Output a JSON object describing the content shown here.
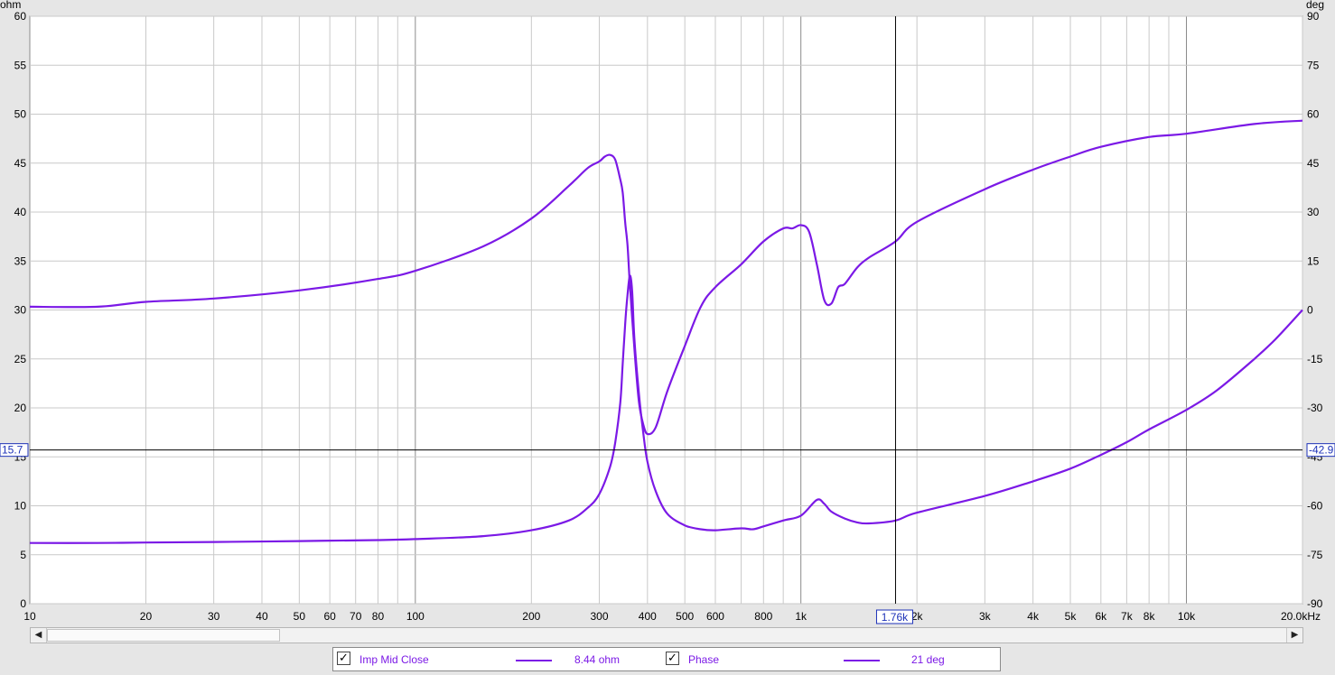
{
  "chart_data": {
    "type": "line",
    "x_scale": "log",
    "xlim": [
      10,
      20000
    ],
    "x_unit": "Hz",
    "x_ticks": [
      "10",
      "20",
      "30",
      "40",
      "50",
      "60",
      "70",
      "80",
      "100",
      "200",
      "300",
      "400",
      "500",
      "600",
      "800",
      "1k",
      "2k",
      "3k",
      "4k",
      "5k",
      "6k",
      "7k",
      "8k",
      "10k",
      "20.0kHz"
    ],
    "x_tick_values": [
      10,
      20,
      30,
      40,
      50,
      60,
      70,
      80,
      100,
      200,
      300,
      400,
      500,
      600,
      800,
      1000,
      2000,
      3000,
      4000,
      5000,
      6000,
      7000,
      8000,
      10000,
      20000
    ],
    "y_left": {
      "unit": "ohm",
      "lim": [
        0,
        60
      ],
      "ticks": [
        "0",
        "5",
        "10",
        "15",
        "20",
        "25",
        "30",
        "35",
        "40",
        "45",
        "50",
        "55",
        "60"
      ]
    },
    "y_right": {
      "unit": "deg",
      "lim": [
        -90,
        90
      ],
      "ticks": [
        "-90",
        "-75",
        "-60",
        "-45",
        "-30",
        "-15",
        "0",
        "15",
        "30",
        "45",
        "60",
        "75",
        "90"
      ]
    },
    "grid": true,
    "series": [
      {
        "name": "Imp Mid Close",
        "axis": "left",
        "color": "#7b19e6",
        "x": [
          10,
          15,
          20,
          30,
          50,
          80,
          100,
          150,
          200,
          250,
          280,
          300,
          320,
          330,
          340,
          345,
          350,
          355,
          360,
          365,
          370,
          380,
          390,
          400,
          420,
          450,
          500,
          550,
          600,
          700,
          750,
          800,
          900,
          1000,
          1100,
          1150,
          1200,
          1300,
          1400,
          1500,
          1760,
          2000,
          3000,
          4000,
          5000,
          6000,
          7000,
          8000,
          10000,
          12000,
          15000,
          17000,
          20000
        ],
        "y": [
          6.2,
          6.2,
          6.25,
          6.3,
          6.4,
          6.5,
          6.6,
          6.9,
          7.5,
          8.5,
          9.8,
          11.2,
          14.0,
          16.5,
          20.5,
          24.5,
          28.5,
          31.5,
          33.5,
          32.0,
          27.0,
          21.5,
          17.5,
          14.5,
          11.5,
          9.2,
          8.0,
          7.6,
          7.5,
          7.7,
          7.6,
          7.9,
          8.5,
          9.0,
          10.6,
          10.2,
          9.4,
          8.7,
          8.3,
          8.2,
          8.5,
          9.3,
          11.0,
          12.5,
          13.8,
          15.2,
          16.5,
          17.8,
          19.8,
          21.8,
          25.0,
          27.0,
          30.0
        ]
      },
      {
        "name": "Phase",
        "axis": "right",
        "color": "#7b19e6",
        "x": [
          10,
          15,
          20,
          30,
          50,
          80,
          100,
          150,
          200,
          250,
          280,
          300,
          310,
          320,
          330,
          340,
          345,
          350,
          355,
          360,
          370,
          380,
          390,
          400,
          420,
          450,
          500,
          550,
          600,
          700,
          800,
          900,
          950,
          1000,
          1050,
          1100,
          1150,
          1200,
          1250,
          1300,
          1400,
          1500,
          1760,
          2000,
          3000,
          4000,
          5000,
          6000,
          8000,
          10000,
          15000,
          20000
        ],
        "y": [
          1,
          1,
          2.5,
          3.5,
          6,
          9.5,
          12,
          19.5,
          28,
          38,
          43.5,
          45.5,
          47,
          47.5,
          46,
          40,
          36,
          27,
          20,
          8,
          -12,
          -28,
          -35,
          -38,
          -36,
          -25,
          -11,
          1,
          7,
          14,
          21,
          25,
          25,
          26,
          24,
          14,
          3,
          2,
          7,
          8,
          13,
          16,
          21,
          27,
          37,
          43,
          47,
          50,
          53,
          54,
          57,
          58
        ]
      }
    ],
    "cursor": {
      "x_label": "1.76k",
      "y_left_label": "15.7",
      "y_right_label": "-42.9",
      "x_value": 1760,
      "y_value": 15.7
    }
  },
  "legend": {
    "items": [
      {
        "name": "Imp Mid Close",
        "value": "8.44 ohm",
        "checked": true,
        "checkmark": "✓"
      },
      {
        "name": "Phase",
        "value": "21 deg",
        "checked": true,
        "checkmark": "✓"
      }
    ]
  },
  "scrollbar": {
    "left_arrow": "◀",
    "right_arrow": "▶"
  }
}
